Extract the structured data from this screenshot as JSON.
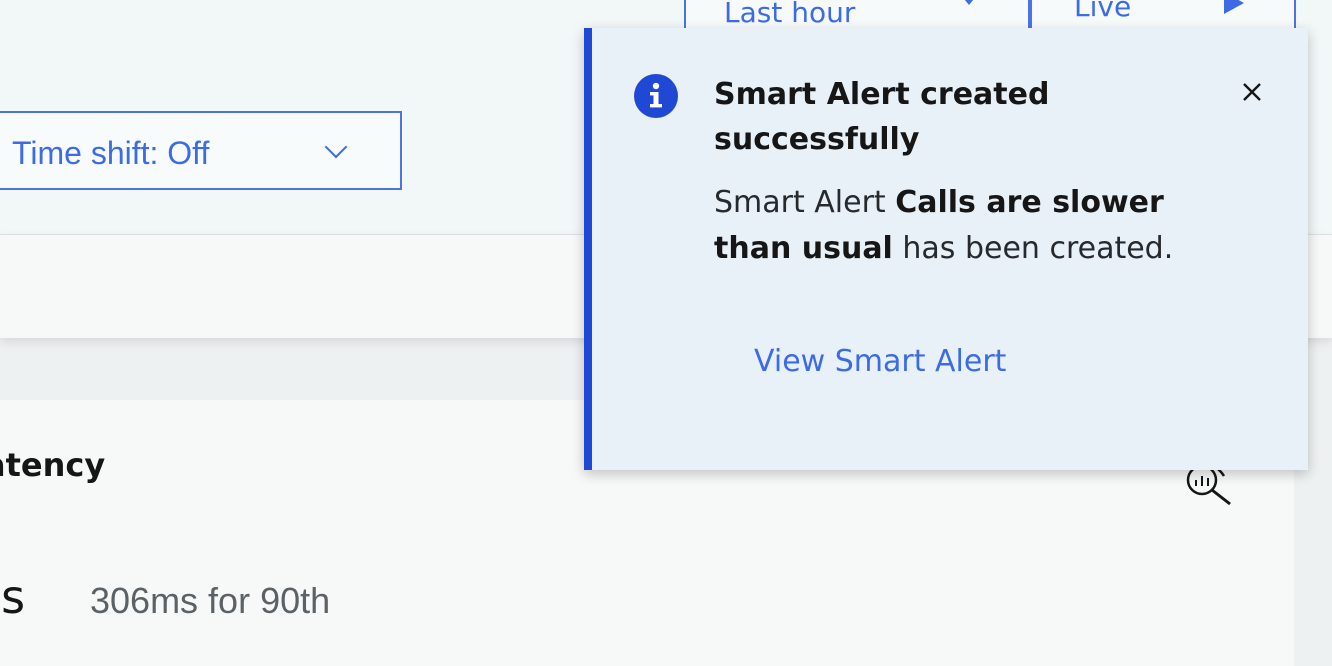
{
  "header": {
    "time_range_label": "Last hour",
    "live_label": "Live",
    "time_shift_label": "Time shift: Off"
  },
  "card": {
    "title": "atency",
    "value": "ns",
    "subvalue": "306ms for 90th"
  },
  "toast": {
    "title": "Smart Alert created successfully",
    "body_prefix": "Smart Alert ",
    "body_bold": "Calls are slower than usual",
    "body_suffix": " has been created.",
    "link_label": "View Smart Alert"
  },
  "colors": {
    "accent": "#3d6be6",
    "toast_border": "#1f49d4",
    "toast_bg": "#e8f0f8"
  }
}
